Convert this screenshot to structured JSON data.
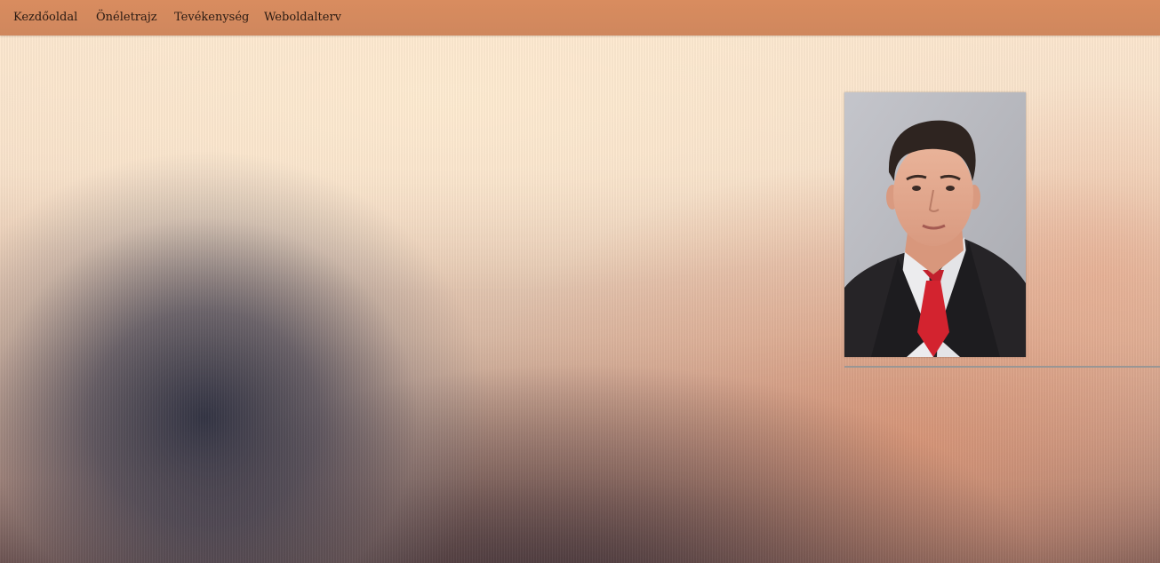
{
  "nav": {
    "items": [
      {
        "label": "Kezdőoldal"
      },
      {
        "label": "Önéletrajz"
      },
      {
        "label": "Tevékenység"
      },
      {
        "label": "Weboldalterv"
      }
    ]
  },
  "profile": {
    "photo_alt": "portrait-photo"
  },
  "colors": {
    "navbar": "#d98c5f",
    "background_top": "#fde8d0",
    "accent_dark": "#2c2f3e"
  }
}
